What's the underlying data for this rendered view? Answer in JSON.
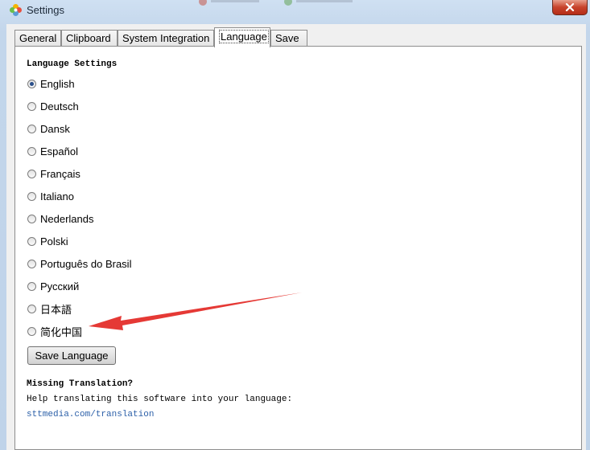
{
  "window": {
    "title": "Settings"
  },
  "tabs": [
    {
      "label": "General",
      "active": false
    },
    {
      "label": "Clipboard",
      "active": false
    },
    {
      "label": "System Integration",
      "active": false
    },
    {
      "label": "Language",
      "active": true
    },
    {
      "label": "Save",
      "active": false
    }
  ],
  "language": {
    "heading": "Language Settings",
    "selected": "English",
    "options": [
      "English",
      "Deutsch",
      "Dansk",
      "Español",
      "Français",
      "Italiano",
      "Nederlands",
      "Polski",
      "Português do Brasil",
      "Русский",
      "日本語",
      "简化中国"
    ],
    "save_button": "Save Language"
  },
  "help": {
    "heading": "Missing Translation?",
    "text": "Help translating this software into your language:",
    "link": "sttmedia.com/translation"
  },
  "colors": {
    "arrow": "#e53935",
    "link": "#2b5fa8",
    "close_button": "#c7432b"
  }
}
